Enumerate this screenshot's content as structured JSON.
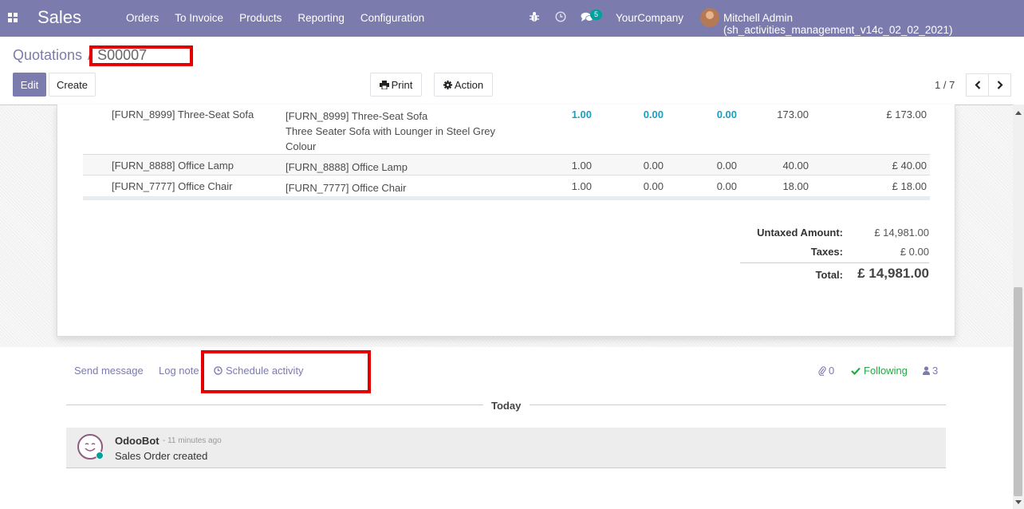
{
  "navbar": {
    "app_name": "Sales",
    "menu": [
      "Orders",
      "To Invoice",
      "Products",
      "Reporting",
      "Configuration"
    ],
    "chat_count": "5",
    "company": "YourCompany",
    "user": "Mitchell Admin (sh_activities_management_v14c_02_02_2021)",
    "color": "#7c7bad"
  },
  "breadcrumb": {
    "parent": "Quotations",
    "separator": "/",
    "current": "S00007"
  },
  "toolbar": {
    "edit_label": "Edit",
    "create_label": "Create",
    "print_label": "Print",
    "action_label": "Action",
    "pager": "1 / 7"
  },
  "order_lines": [
    {
      "product": "[FURN_8999] Three-Seat Sofa",
      "description": [
        "[FURN_8999] Three-Seat Sofa",
        "Three Seater Sofa with Lounger in Steel Grey",
        "Colour"
      ],
      "quantity": "1.00",
      "delivered": "0.00",
      "invoiced": "0.00",
      "unit_price": "173.00",
      "subtotal": "£ 173.00"
    },
    {
      "product": "[FURN_8888] Office Lamp",
      "description": [
        "[FURN_8888] Office Lamp"
      ],
      "quantity": "1.00",
      "delivered": "0.00",
      "invoiced": "0.00",
      "unit_price": "40.00",
      "subtotal": "£ 40.00"
    },
    {
      "product": "[FURN_7777] Office Chair",
      "description": [
        "[FURN_7777] Office Chair"
      ],
      "quantity": "1.00",
      "delivered": "0.00",
      "invoiced": "0.00",
      "unit_price": "18.00",
      "subtotal": "£ 18.00"
    }
  ],
  "totals": {
    "untaxed_label": "Untaxed Amount:",
    "untaxed_value": "£ 14,981.00",
    "taxes_label": "Taxes:",
    "taxes_value": "£ 0.00",
    "total_label": "Total:",
    "total_value": "£ 14,981.00"
  },
  "chatter": {
    "send_message": "Send message",
    "log_note": "Log note",
    "schedule_activity": "Schedule activity",
    "attachments_count": "0",
    "following": "Following",
    "followers_count": "3",
    "date_separator": "Today",
    "messages": [
      {
        "author": "OdooBot",
        "time": "- 11 minutes ago",
        "body": "Sales Order created"
      }
    ]
  }
}
